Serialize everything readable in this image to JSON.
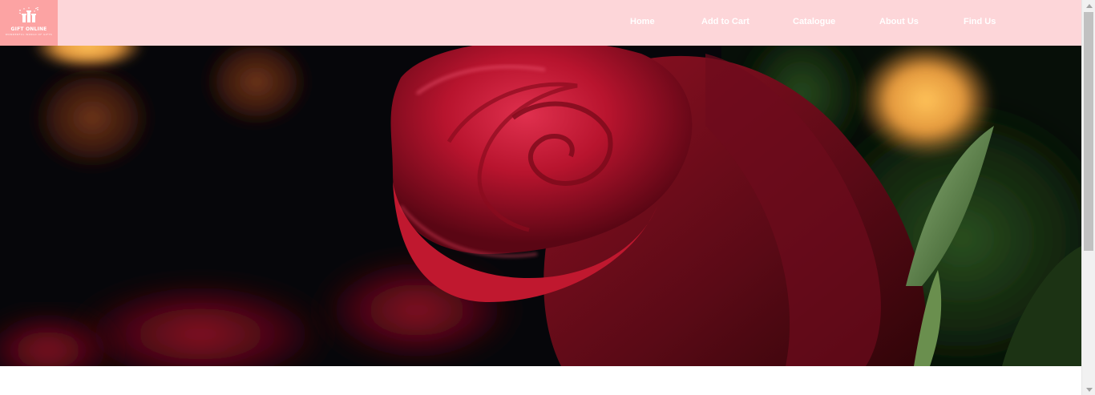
{
  "brand": {
    "title": "GIFT ONLINE",
    "tagline": "WONDERFUL WORLD OF GIFTS",
    "icon": "gift-boxes-icon"
  },
  "nav": {
    "items": [
      {
        "label": "Home"
      },
      {
        "label": "Add to Cart"
      },
      {
        "label": "Catalogue"
      },
      {
        "label": "About Us"
      },
      {
        "label": "Find Us"
      }
    ]
  },
  "hero": {
    "image": "red-rose-bokeh-photo"
  },
  "colors": {
    "header_bg": "#fdd6d9",
    "logo_bg": "#fca3a3",
    "nav_text": "#ffffff"
  },
  "scrollbar": {
    "up_icon": "scroll-up-arrow-icon",
    "down_icon": "scroll-down-arrow-icon"
  }
}
